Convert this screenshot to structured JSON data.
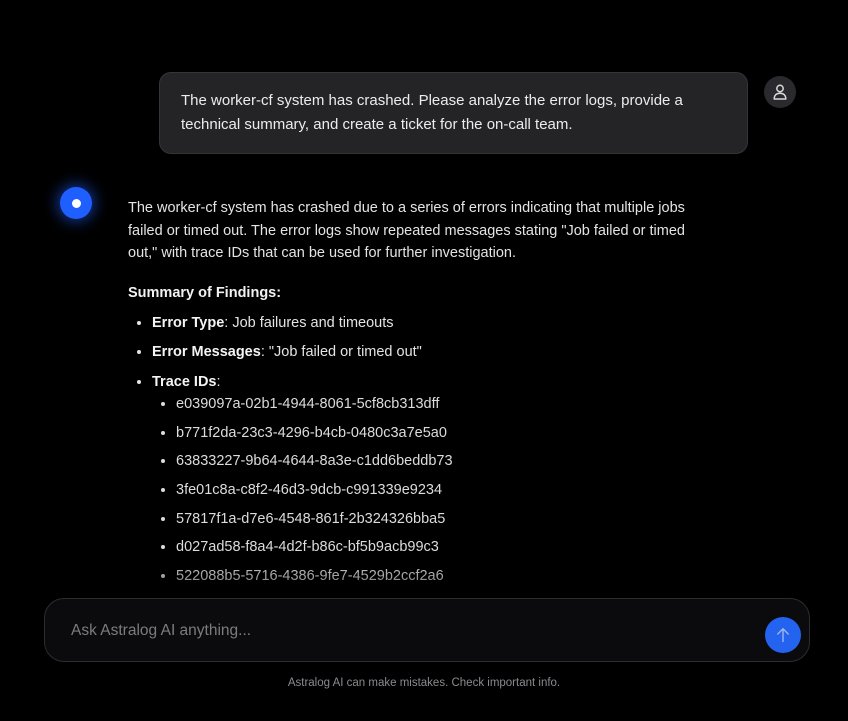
{
  "user_message": {
    "text": "The worker-cf system has crashed. Please analyze the error logs, provide a technical summary, and create a ticket for the on-call team."
  },
  "assistant_message": {
    "intro": "The worker-cf system has crashed due to a series of errors indicating that multiple jobs failed or timed out. The error logs show repeated messages stating \"Job failed or timed out,\" with trace IDs that can be used for further investigation.",
    "summary_heading": "Summary of Findings:",
    "findings": [
      {
        "label": "Error Type",
        "value": ": Job failures and timeouts"
      },
      {
        "label": "Error Messages",
        "value": ": \"Job failed or timed out\""
      },
      {
        "label": "Trace IDs",
        "value": ":"
      }
    ],
    "trace_ids": [
      "e039097a-02b1-4944-8061-5cf8cb313dff",
      "b771f2da-23c3-4296-b4cb-0480c3a7e5a0",
      "63833227-9b64-4644-8a3e-c1dd6beddb73",
      "3fe01c8a-c8f2-46d3-9dcb-c991339e9234",
      "57817f1a-d7e6-4548-861f-2b324326bba5",
      "d027ad58-f8a4-4d2f-b86c-bf5b9acb99c3",
      "522088b5-5716-4386-9fe7-4529b2ccf2a6"
    ]
  },
  "input": {
    "placeholder": "Ask Astralog AI anything...",
    "value": ""
  },
  "disclaimer": "Astralog AI can make mistakes. Check important info.",
  "icons": {
    "user_avatar": "person-icon",
    "assistant_avatar": "assistant-dot-icon",
    "send": "arrow-up-icon"
  },
  "colors": {
    "accent": "#2462f0",
    "background": "#000000",
    "user_bubble": "#242427"
  }
}
